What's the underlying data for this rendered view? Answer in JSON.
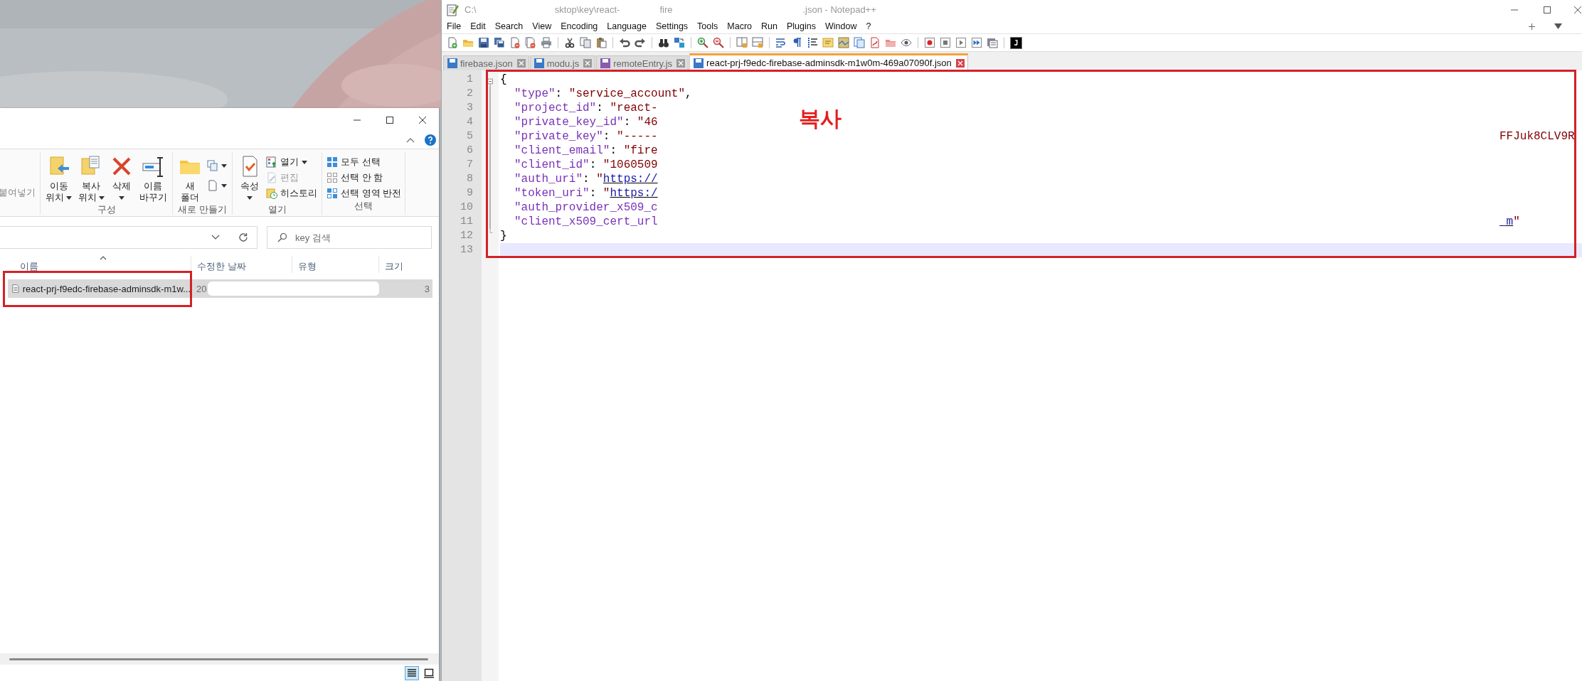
{
  "explorer": {
    "ribbon": {
      "paste": "붙여넣기",
      "groups": [
        {
          "label": "구성",
          "large": [
            {
              "lines": [
                "이동",
                "위치"
              ],
              "dropdown": true
            },
            {
              "lines": [
                "복사",
                "위치"
              ],
              "dropdown": true
            },
            {
              "lines": [
                "삭제"
              ],
              "dropdown": true
            },
            {
              "lines": [
                "이름",
                "바꾸기"
              ],
              "dropdown": false
            }
          ]
        },
        {
          "label": "새로 만들기",
          "large": [
            {
              "lines": [
                "새",
                "폴더"
              ],
              "dropdown": false
            }
          ],
          "small": [
            {
              "dropdown": true,
              "disabled": false
            },
            {
              "dropdown": true,
              "disabled": false
            }
          ]
        },
        {
          "label": "열기",
          "large": [
            {
              "lines": [
                "속성"
              ],
              "dropdown": true
            }
          ],
          "small": [
            {
              "label": "열기",
              "dropdown": true,
              "disabled": false
            },
            {
              "label": "편집",
              "dropdown": false,
              "disabled": true
            },
            {
              "label": "히스토리",
              "dropdown": false,
              "disabled": false
            }
          ]
        },
        {
          "label": "선택",
          "small": [
            {
              "label": "모두 선택",
              "dropdown": false,
              "disabled": false
            },
            {
              "label": "선택 안 함",
              "dropdown": false,
              "disabled": false
            },
            {
              "label": "선택 영역 반전",
              "dropdown": false,
              "disabled": false
            }
          ]
        }
      ]
    },
    "search": {
      "placeholder": "key 검색"
    },
    "columns": [
      "이름",
      "수정한 날짜",
      "유형",
      "크기"
    ],
    "files": [
      {
        "name": "react-prj-f9edc-firebase-adminsdk-m1w...",
        "date": "20",
        "size": "3",
        "selected": true
      }
    ],
    "view_buttons": [
      {
        "selected": true
      },
      {
        "selected": false
      }
    ]
  },
  "notepad": {
    "title_parts": [
      "C:\\",
      "sktop\\key\\react-",
      "fire",
      ".json - Notepad++"
    ],
    "menu": [
      "File",
      "Edit",
      "Search",
      "View",
      "Encoding",
      "Language",
      "Settings",
      "Tools",
      "Macro",
      "Run",
      "Plugins",
      "Window",
      "?"
    ],
    "toolbar_badge": "J",
    "tabs": [
      {
        "label": "firebase.json",
        "selected": false,
        "color": "#3a78c8"
      },
      {
        "label": "modu.js",
        "selected": false,
        "color": "#3a78c8"
      },
      {
        "label": "remoteEntry.js",
        "selected": false,
        "color": "#8a5ab0"
      },
      {
        "label": "react-prj-f9edc-firebase-adminsdk-m1w0m-469a07090f.json",
        "selected": true,
        "color": "#3a78c8"
      }
    ],
    "editor": {
      "lines": [
        {
          "number": "1",
          "kind": "start",
          "current": false,
          "tokens": [
            {
              "kind": "punct",
              "text": "{"
            }
          ]
        },
        {
          "number": "2",
          "kind": "body",
          "current": false,
          "tokens": [
            {
              "kind": "key",
              "text": "\"type\""
            },
            {
              "kind": "punct",
              "text": ": "
            },
            {
              "kind": "string",
              "text": "\"service_account\""
            },
            {
              "kind": "punct",
              "text": ","
            }
          ]
        },
        {
          "number": "3",
          "kind": "body",
          "current": false,
          "tokens": [
            {
              "kind": "key",
              "text": "\"project_id\""
            },
            {
              "kind": "punct",
              "text": ": "
            },
            {
              "kind": "string",
              "text": "\"react-"
            }
          ]
        },
        {
          "number": "4",
          "kind": "body",
          "current": false,
          "tokens": [
            {
              "kind": "key",
              "text": "\"private_key_id\""
            },
            {
              "kind": "punct",
              "text": ": "
            },
            {
              "kind": "string",
              "text": "\"46"
            }
          ]
        },
        {
          "number": "5",
          "kind": "body",
          "current": false,
          "tokens": [
            {
              "kind": "key",
              "text": "\"private_key\""
            },
            {
              "kind": "punct",
              "text": ": "
            },
            {
              "kind": "string",
              "text": "\"-----"
            }
          ],
          "tail": [
            {
              "kind": "string",
              "text": "FFJuk8CLV9R"
            }
          ]
        },
        {
          "number": "6",
          "kind": "body",
          "current": false,
          "tokens": [
            {
              "kind": "key",
              "text": "\"client_email\""
            },
            {
              "kind": "punct",
              "text": ": "
            },
            {
              "kind": "string",
              "text": "\"fire"
            }
          ]
        },
        {
          "number": "7",
          "kind": "body",
          "current": false,
          "tokens": [
            {
              "kind": "key",
              "text": "\"client_id\""
            },
            {
              "kind": "punct",
              "text": ": "
            },
            {
              "kind": "string",
              "text": "\"1060509"
            }
          ]
        },
        {
          "number": "8",
          "kind": "body",
          "current": false,
          "tokens": [
            {
              "kind": "key",
              "text": "\"auth_uri\""
            },
            {
              "kind": "punct",
              "text": ": "
            },
            {
              "kind": "string",
              "text": "\""
            },
            {
              "kind": "url",
              "text": "https://"
            }
          ]
        },
        {
          "number": "9",
          "kind": "body",
          "current": false,
          "tokens": [
            {
              "kind": "key",
              "text": "\"token_uri\""
            },
            {
              "kind": "punct",
              "text": ": "
            },
            {
              "kind": "string",
              "text": "\""
            },
            {
              "kind": "url",
              "text": "https:/"
            }
          ]
        },
        {
          "number": "10",
          "kind": "body",
          "current": false,
          "tokens": [
            {
              "kind": "key",
              "text": "\"auth_provider_x509_c"
            }
          ]
        },
        {
          "number": "11",
          "kind": "body",
          "current": false,
          "tokens": [
            {
              "kind": "key",
              "text": "\"client_x509_cert_url"
            }
          ],
          "tail": [
            {
              "kind": "url",
              "text": "_m"
            },
            {
              "kind": "string",
              "text": "\""
            }
          ]
        },
        {
          "number": "12",
          "kind": "end",
          "current": false,
          "tokens": [
            {
              "kind": "punct",
              "text": "}"
            }
          ]
        },
        {
          "number": "13",
          "kind": "plain",
          "current": true
        }
      ]
    },
    "annotation": "복사"
  }
}
